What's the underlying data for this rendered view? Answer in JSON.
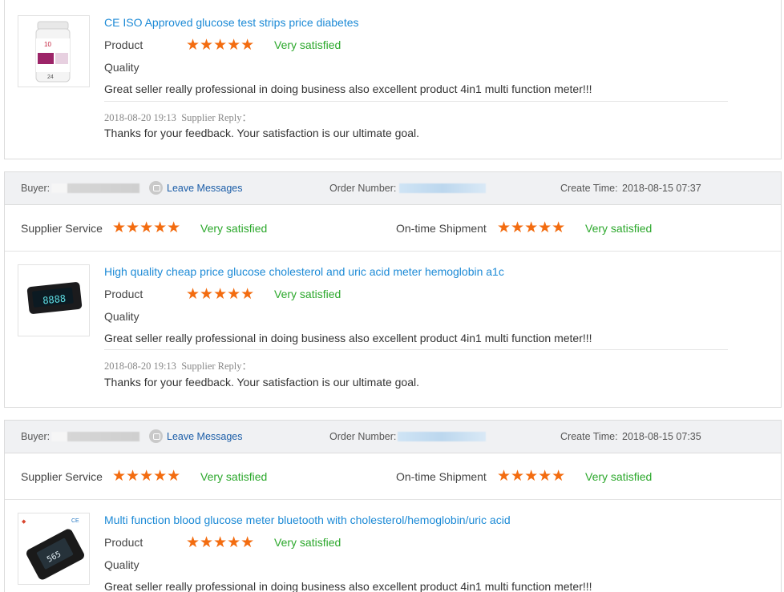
{
  "labels": {
    "buyer": "Buyer:",
    "leave_messages": "Leave Messages",
    "order_number": "Order Number:",
    "create_time": "Create Time:",
    "supplier_service": "Supplier Service",
    "ontime_shipment": "On-time Shipment",
    "product": "Product",
    "quality": "Quality",
    "supplier_reply": "Supplier Reply：",
    "star_glyphs": "★★★★★"
  },
  "colors": {
    "star": "#f36c10",
    "satisfied": "#2ca82c",
    "title_link": "#1c8ad6",
    "msg_link": "#1c5ea8"
  },
  "reviews": [
    {
      "product_title": "CE ISO Approved glucose test strips price diabetes",
      "product_rating": 5,
      "product_rating_text": "Very satisfied",
      "review_text": "Great seller really professional in doing business also excellent product 4in1 multi function meter!!!",
      "reply_time": "2018-08-20 19:13",
      "reply_text": "Thanks for your feedback. Your satisfaction is our ultimate goal."
    },
    {
      "create_time": "2018-08-15 07:37",
      "supplier_service_rating": 5,
      "supplier_service_text": "Very satisfied",
      "shipment_rating": 5,
      "shipment_text": "Very satisfied",
      "product_title": "High quality cheap price glucose cholesterol and uric acid meter hemoglobin a1c",
      "product_rating": 5,
      "product_rating_text": "Very satisfied",
      "review_text": "Great seller really professional in doing business also excellent product 4in1 multi function meter!!!",
      "reply_time": "2018-08-20 19:13",
      "reply_text": "Thanks for your feedback. Your satisfaction is our ultimate goal."
    },
    {
      "create_time": "2018-08-15 07:35",
      "supplier_service_rating": 5,
      "supplier_service_text": "Very satisfied",
      "shipment_rating": 5,
      "shipment_text": "Very satisfied",
      "product_title": "Multi function blood glucose meter bluetooth with cholesterol/hemoglobin/uric acid",
      "product_rating": 5,
      "product_rating_text": "Very satisfied",
      "review_text": "Great seller really professional in doing business also excellent product 4in1 multi function meter!!!"
    }
  ],
  "thumbnails": [
    {
      "icon": "test-strip-bottle-icon",
      "text_large": "10",
      "text_small": "24"
    },
    {
      "icon": "glucose-meter-icon",
      "display": "8888"
    },
    {
      "icon": "bluetooth-glucose-meter-icon",
      "display": "565",
      "badge": "CE"
    }
  ]
}
